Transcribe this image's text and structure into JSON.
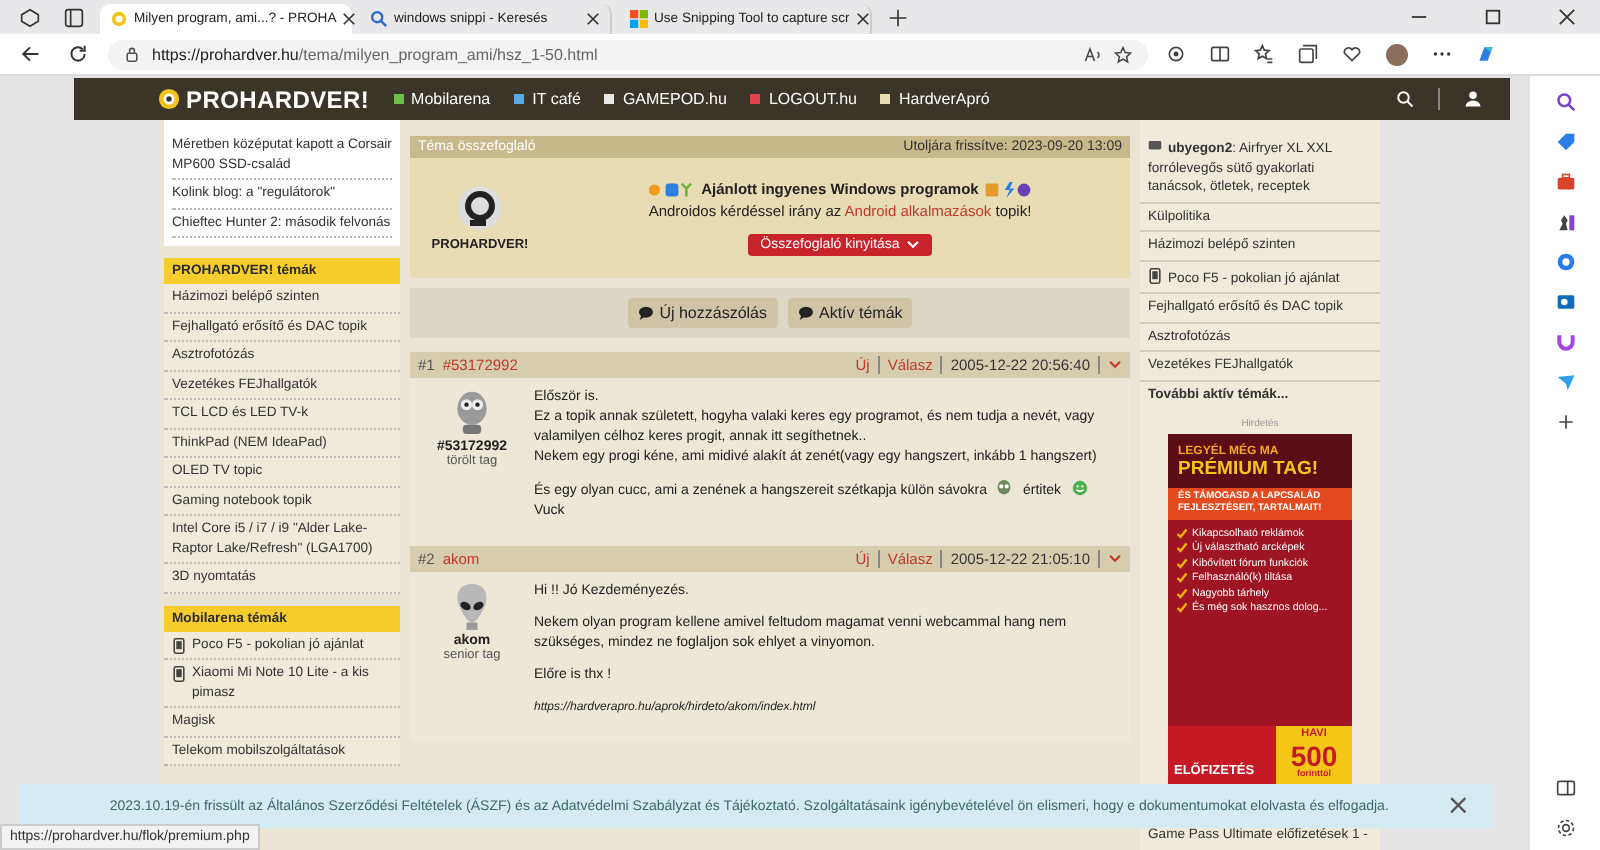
{
  "browser": {
    "tabs": [
      {
        "title": "Milyen program, ami...? - PROHA",
        "selected": true
      },
      {
        "title": "windows snippi - Keresés",
        "selected": false
      },
      {
        "title": "Use Snipping Tool to capture scr",
        "selected": false
      }
    ],
    "url_host": "https://prohardver.hu",
    "url_path": "/tema/milyen_program_ami/hsz_1-50.html"
  },
  "site": {
    "logo": "PROHARDVER!",
    "nav": [
      {
        "label": "Mobilarena",
        "color": "#6cc04a"
      },
      {
        "label": "IT café",
        "color": "#5aa9e6"
      },
      {
        "label": "GAMEPOD.hu",
        "color": "#e8e8e8"
      },
      {
        "label": "LOGOUT.hu",
        "color": "#e0414a"
      },
      {
        "label": "HardverApró",
        "color": "#e8dcb0"
      }
    ]
  },
  "left": {
    "news": [
      "Méretben középutat kapott a Corsair MP600 SSD-család",
      "Kolink blog: a \"regulátorok\"",
      "Chieftec Hunter 2: második felvonás"
    ],
    "sections": [
      {
        "title": "PROHARDVER! témák",
        "items": [
          {
            "label": "Házimozi belépő szinten",
            "kind": "plain"
          },
          {
            "label": "Fejhallgató erősítő és DAC topik",
            "kind": "plain"
          },
          {
            "label": "Asztrofotózás",
            "kind": "plain"
          },
          {
            "label": "Vezetékes FEJhallgatók",
            "kind": "plain"
          },
          {
            "label": "TCL LCD és LED TV-k",
            "kind": "plain"
          },
          {
            "label": "ThinkPad (NEM IdeaPad)",
            "kind": "plain"
          },
          {
            "label": "OLED TV topic",
            "kind": "plain"
          },
          {
            "label": "Gaming notebook topik",
            "kind": "plain"
          },
          {
            "label": "Intel Core i5 / i7 / i9 \"Alder Lake-Raptor Lake/Refresh\" (LGA1700)",
            "kind": "plain"
          },
          {
            "label": "3D nyomtatás",
            "kind": "plain"
          }
        ]
      },
      {
        "title": "Mobilarena témák",
        "items": [
          {
            "label": "Poco F5 - pokolian jó ajánlat",
            "kind": "phone"
          },
          {
            "label": "Xiaomi Mi Note 10 Lite - a kis pimasz",
            "kind": "phone"
          },
          {
            "label": "Magisk",
            "kind": "plain"
          },
          {
            "label": "Telekom mobilszolgáltatások",
            "kind": "plain"
          }
        ]
      }
    ]
  },
  "summary": {
    "title": "Téma összefoglaló",
    "updated": "Utoljára frissítve: 2023-09-20 13:09",
    "logo_text": "PROHARDVER!",
    "headline": "Ajánlott ingyenes Windows programok",
    "line_before": "Androidos kérdéssel irány az",
    "line_link": "Android alkalmazások",
    "line_after": "topik!",
    "button": "Összefoglaló kinyitása"
  },
  "actions": [
    "Új hozzászólás",
    "Aktív témák"
  ],
  "posts": [
    {
      "number": "#1",
      "author_link": "#53172992",
      "new": "Új",
      "reply": "Válasz",
      "date": "2005-12-22 20:56:40",
      "name": "#53172992",
      "rank": "törölt tag",
      "paragraphs": [
        [
          {
            "kind": "text",
            "text": "Először is."
          },
          {
            "kind": "break"
          },
          {
            "kind": "text",
            "text": "Ez a topik annak született, hogyha valaki keres egy programot, és nem tudja a nevét, vagy valamilyen célhoz keres progit, annak itt segíthetnek.."
          },
          {
            "kind": "break"
          },
          {
            "kind": "text",
            "text": "Nekem egy progi kéne, ami midivé alakít át zenét(vagy egy hangszert, inkább 1 hangszert)"
          }
        ],
        [
          {
            "kind": "text",
            "text": "És egy olyan cucc, ami a zenének a hangszereit szétkapja külön sávokra"
          },
          {
            "kind": "alien-smiley"
          },
          {
            "kind": "text",
            "text": "értitek"
          },
          {
            "kind": "smiley"
          },
          {
            "kind": "break"
          },
          {
            "kind": "text",
            "text": "Vuck"
          }
        ]
      ]
    },
    {
      "number": "#2",
      "author_link": "akom",
      "new": "Új",
      "reply": "Válasz",
      "date": "2005-12-22 21:05:10",
      "name": "akom",
      "rank": "senior tag",
      "paragraphs": [
        [
          {
            "kind": "text",
            "text": "Hi !! Jó Kezdeményezés."
          }
        ],
        [
          {
            "kind": "text",
            "text": "Nekem olyan program kellene amivel feltudom magamat venni webcammal hang nem szükséges, mindez ne foglaljon sok ehlyet a vinyomon."
          }
        ],
        [
          {
            "kind": "text",
            "text": "Előre is thx !"
          }
        ],
        [
          {
            "kind": "signature",
            "text": "https://hardverapro.hu/aprok/hirdeto/akom/index.html"
          }
        ]
      ]
    }
  ],
  "right": {
    "items": [
      {
        "kind": "user",
        "user": "ubyegon2",
        "label": ": Airfryer XL XXL forrólevegős sütő gyakorlati tanácsok, ötletek, receptek"
      },
      {
        "kind": "plain",
        "label": "Külpolitika"
      },
      {
        "kind": "plain",
        "label": "Házimozi belépő szinten"
      },
      {
        "kind": "phone",
        "label": "Poco F5 - pokolian jó ajánlat"
      },
      {
        "kind": "plain",
        "label": "Fejhallgató erősítő és DAC topik"
      },
      {
        "kind": "plain",
        "label": "Asztrofotózás"
      },
      {
        "kind": "plain",
        "label": "Vezetékes FEJhallgatók"
      },
      {
        "kind": "more",
        "label": "További aktív témák..."
      }
    ],
    "ad_label": "Hirdetés",
    "banner": {
      "line1": "LEGYÉL MÉG MA",
      "line2": "PRÉMIUM TAG!",
      "sub": "ÉS TÁMOGASD A LAPCSALÁD FEJLESZTÉSEIT, TARTALMAIT!",
      "features": [
        "Kikapcsolható reklámok",
        "Új választható arcképek",
        "Kibővített fórum funkciók",
        "Felhasználó(k) tiltása",
        "Nagyobb tárhely",
        "És még sok hasznos dolog..."
      ],
      "cta": "ELŐFIZETÉS",
      "price_top": "HAVI",
      "price": "500",
      "price_bottom": "forinttól"
    },
    "after": "Game Pass Ultimate előfizetések 1 -"
  },
  "cookie": {
    "text": "2023.10.19-én frissült az Általános Szerződési Feltételek (ÁSZF) és az Adatvédelmi Szabályzat és Tájékoztató. Szolgáltatásaink igénybevételével ön elismeri, hogy e dokumentumokat elolvasta és elfogadja.",
    "close": "×"
  },
  "status_url": "https://prohardver.hu/flok/premium.php"
}
